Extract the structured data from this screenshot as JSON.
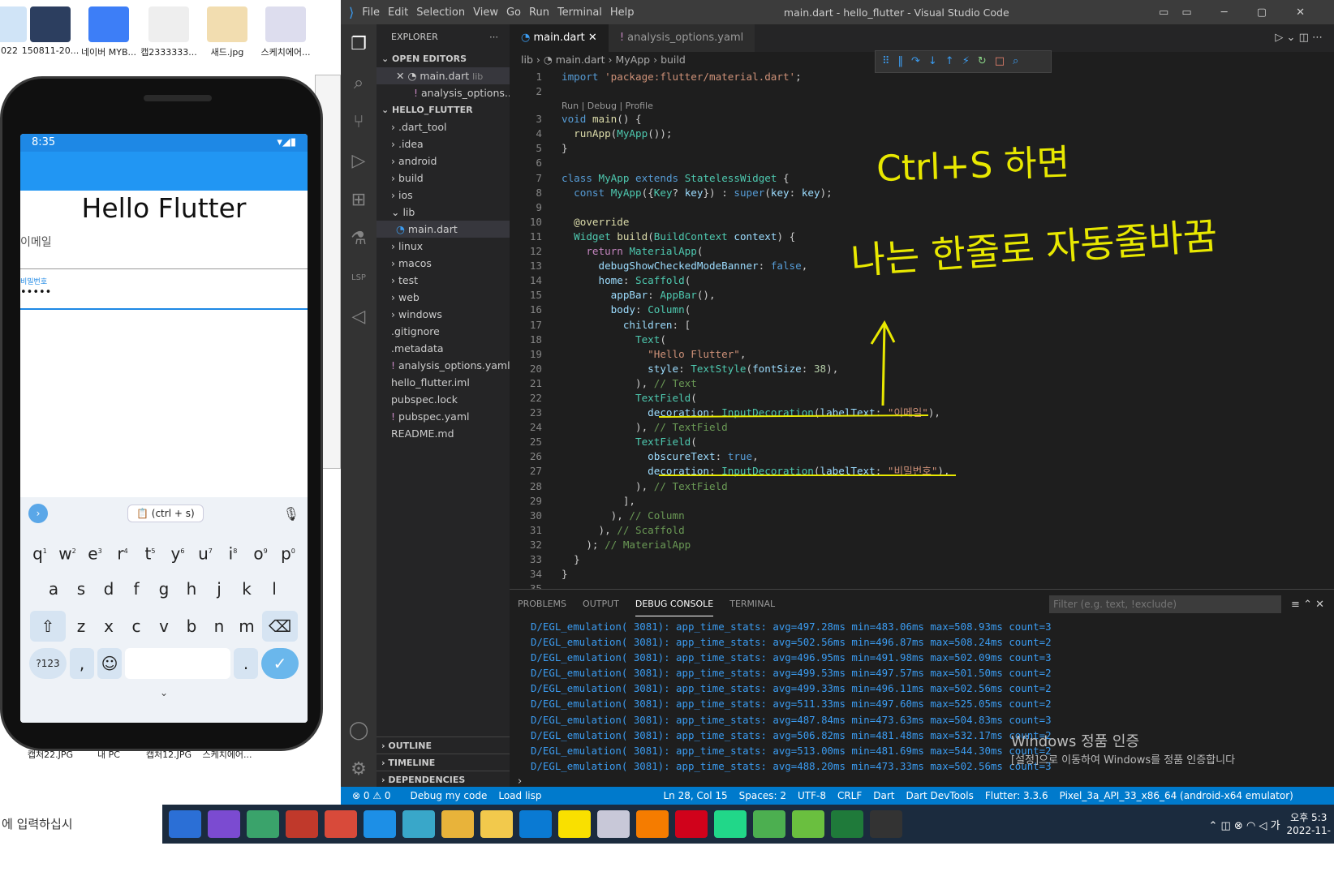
{
  "desktop": {
    "icons_top": [
      "2022",
      "150811-20...",
      "네이버 MYB...",
      "캡2333333...",
      "새드.jpg",
      "스케치에어..."
    ],
    "icons_bottom": [
      "캡처22.JPG",
      "내 PC",
      "캡처12.JPG",
      "스케치에어..."
    ],
    "search_text": "에 입력하십시"
  },
  "phone": {
    "time": "8:35",
    "title": "Hello Flutter",
    "email_label": "이메일",
    "password_label": "비밀번호",
    "password_value": "•••••",
    "clipboard_chip": "(ctrl + s)",
    "row1": [
      "q",
      "w",
      "e",
      "r",
      "t",
      "y",
      "u",
      "i",
      "o",
      "p"
    ],
    "row1_hints": [
      "1",
      "2",
      "3",
      "4",
      "5",
      "6",
      "7",
      "8",
      "9",
      "0"
    ],
    "row2": [
      "a",
      "s",
      "d",
      "f",
      "g",
      "h",
      "j",
      "k",
      "l"
    ],
    "row3": [
      "z",
      "x",
      "c",
      "v",
      "b",
      "n",
      "m"
    ],
    "sym_key": "?123",
    "comma": ",",
    "period": "."
  },
  "vscode": {
    "menu": [
      "File",
      "Edit",
      "Selection",
      "View",
      "Go",
      "Run",
      "Terminal",
      "Help"
    ],
    "window_title": "main.dart - hello_flutter - Visual Studio Code",
    "explorer": {
      "title": "EXPLORER",
      "open_editors": "OPEN EDITORS",
      "open_items": [
        {
          "name": "main.dart",
          "hint": "lib"
        },
        {
          "name": "analysis_options....",
          "hint": ""
        }
      ],
      "project": "HELLO_FLUTTER",
      "tree": [
        ".dart_tool",
        ".idea",
        "android",
        "build",
        "ios",
        "lib",
        "main.dart",
        "linux",
        "macos",
        "test",
        "web",
        "windows",
        ".gitignore",
        ".metadata",
        "analysis_options.yaml",
        "hello_flutter.iml",
        "pubspec.lock",
        "pubspec.yaml",
        "README.md"
      ],
      "outline": "OUTLINE",
      "timeline": "TIMELINE",
      "dependencies": "DEPENDENCIES"
    },
    "tabs": [
      "main.dart",
      "analysis_options.yaml"
    ],
    "breadcrumb": [
      "lib",
      "main.dart",
      "MyApp",
      "build"
    ],
    "codelens": "Run | Debug | Profile",
    "panel_tabs": [
      "PROBLEMS",
      "OUTPUT",
      "DEBUG CONSOLE",
      "TERMINAL"
    ],
    "filter_placeholder": "Filter (e.g. text, !exclude)",
    "logs": [
      "D/EGL_emulation( 3081): app_time_stats: avg=497.28ms min=483.06ms max=508.93ms count=3",
      "D/EGL_emulation( 3081): app_time_stats: avg=502.56ms min=496.87ms max=508.24ms count=2",
      "D/EGL_emulation( 3081): app_time_stats: avg=496.95ms min=491.98ms max=502.09ms count=3",
      "D/EGL_emulation( 3081): app_time_stats: avg=499.53ms min=497.57ms max=501.50ms count=2",
      "D/EGL_emulation( 3081): app_time_stats: avg=499.33ms min=496.11ms max=502.56ms count=2",
      "D/EGL_emulation( 3081): app_time_stats: avg=511.33ms min=497.60ms max=525.05ms count=2",
      "D/EGL_emulation( 3081): app_time_stats: avg=487.84ms min=473.63ms max=504.83ms count=3",
      "D/EGL_emulation( 3081): app_time_stats: avg=506.82ms min=481.48ms max=532.17ms count=2",
      "D/EGL_emulation( 3081): app_time_stats: avg=513.00ms min=481.69ms max=544.30ms count=2",
      "D/EGL_emulation( 3081): app_time_stats: avg=488.20ms min=473.33ms max=502.56ms count=3"
    ],
    "status": {
      "errors": "⊗ 0 ⚠ 0",
      "debug": "Debug my code",
      "load": "Load lisp",
      "pos": "Ln 28, Col 15",
      "spaces": "Spaces: 2",
      "enc": "UTF-8",
      "eol": "CRLF",
      "lang": "Dart",
      "devtools": "Dart DevTools",
      "flutter": "Flutter: 3.3.6",
      "device": "Pixel_3a_API_33_x86_64 (android-x64 emulator)"
    },
    "annotation_line1": "Ctrl+S 하면",
    "annotation_line2": "나는 한줄로 자동줄바꿈"
  },
  "watermark": {
    "line1": "Windows 정품 인증",
    "line2": "[설정]으로 이동하여 Windows를 정품 인증합니다"
  },
  "clock": {
    "ampm": "오후 5:3",
    "date": "2022-11-",
    "ime": "가"
  }
}
